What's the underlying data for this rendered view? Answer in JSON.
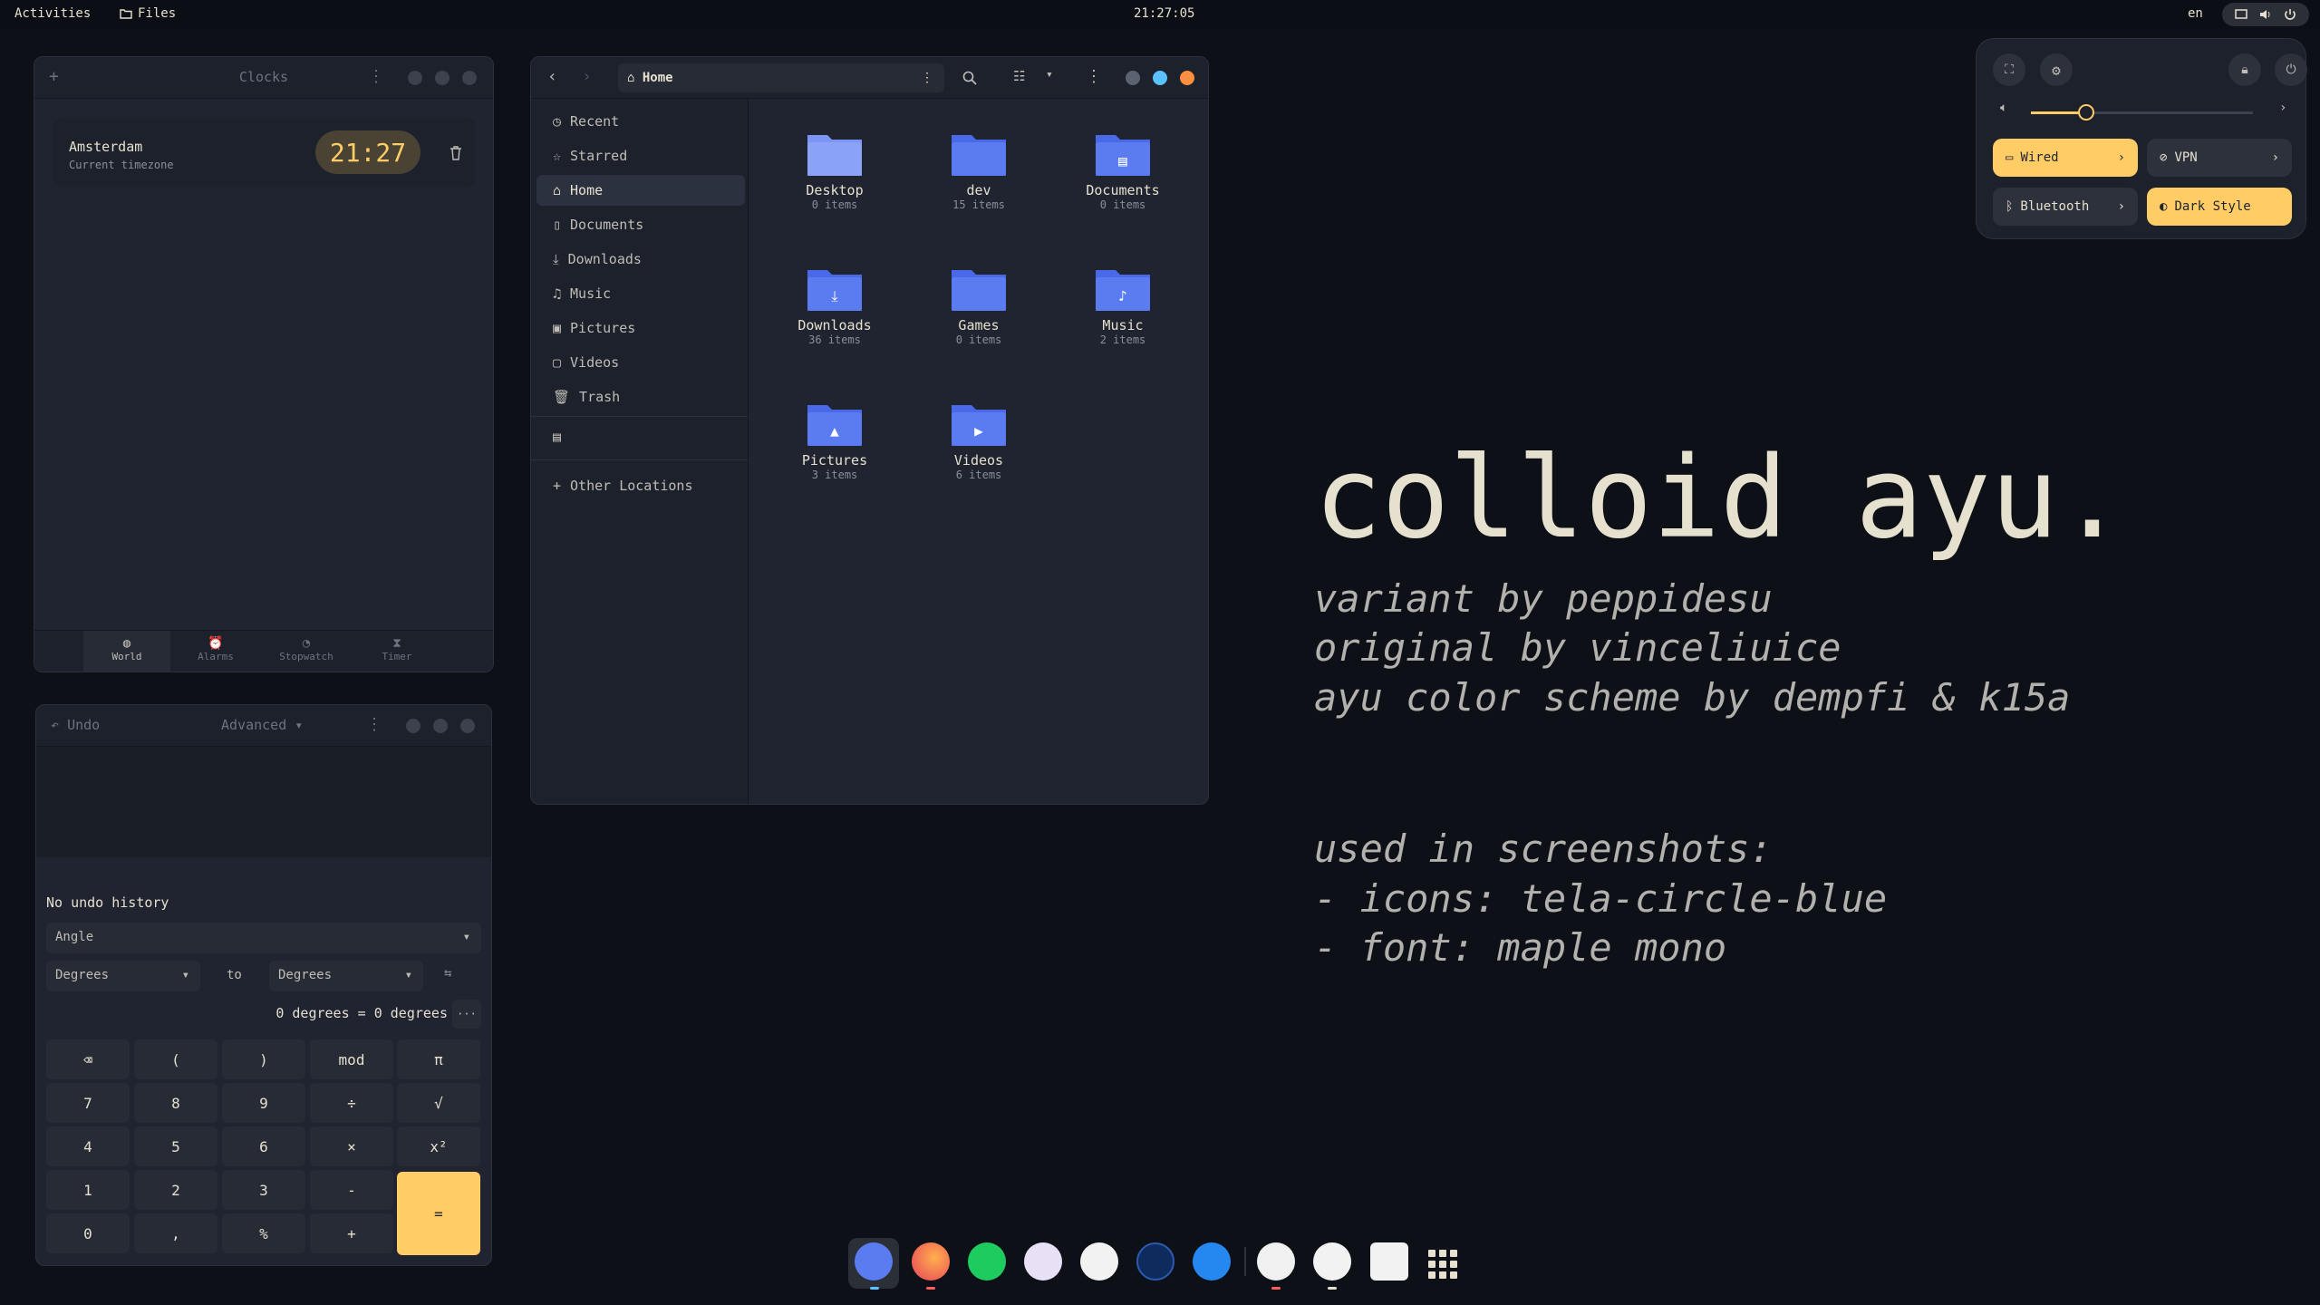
{
  "topbar": {
    "activities": "Activities",
    "app": "Files",
    "clock": "21:27:05",
    "lang": "en"
  },
  "clocks": {
    "title": "Clocks",
    "city": "Amsterdam",
    "tz": "Current timezone",
    "time": "21:27",
    "tabs": [
      "World",
      "Alarms",
      "Stopwatch",
      "Timer"
    ]
  },
  "calc": {
    "undo": "Undo",
    "mode": "Advanced",
    "history": "No undo history",
    "category": "Angle",
    "from": "Degrees",
    "to_label": "to",
    "to": "Degrees",
    "result": "0 degrees = 0 degrees",
    "more": "···",
    "keys": [
      "⌫",
      "(",
      ")",
      "mod",
      "π",
      "7",
      "8",
      "9",
      "÷",
      "√",
      "4",
      "5",
      "6",
      "×",
      "x²",
      "1",
      "2",
      "3",
      "-",
      "0",
      ",",
      "%",
      "+"
    ],
    "equals": "="
  },
  "files": {
    "location": "Home",
    "sidebar": [
      "Recent",
      "Starred",
      "Home",
      "Documents",
      "Downloads",
      "Music",
      "Pictures",
      "Videos",
      "Trash"
    ],
    "other": "Other Locations",
    "items": [
      {
        "name": "Desktop",
        "count": "0 items"
      },
      {
        "name": "dev",
        "count": "15 items"
      },
      {
        "name": "Documents",
        "count": "0 items"
      },
      {
        "name": "Downloads",
        "count": "36 items"
      },
      {
        "name": "Games",
        "count": "0 items"
      },
      {
        "name": "Music",
        "count": "2 items"
      },
      {
        "name": "Pictures",
        "count": "3 items"
      },
      {
        "name": "Videos",
        "count": "6 items"
      }
    ]
  },
  "quick": {
    "volume": 0.25,
    "wired": "Wired",
    "vpn": "VPN",
    "bluetooth": "Bluetooth",
    "dark": "Dark Style"
  },
  "wallpaper": {
    "title": "colloid ayu.",
    "lines": [
      "variant by peppidesu",
      "original by vinceliuice",
      "ayu color scheme by dempfi & k15a"
    ],
    "used": [
      "used in screenshots:",
      "- icons: tela-circle-blue",
      "- font: maple mono"
    ]
  },
  "colors": {
    "accent": "#ffcc66",
    "folder": "#5b7cf0",
    "bg": "#0d1017"
  }
}
